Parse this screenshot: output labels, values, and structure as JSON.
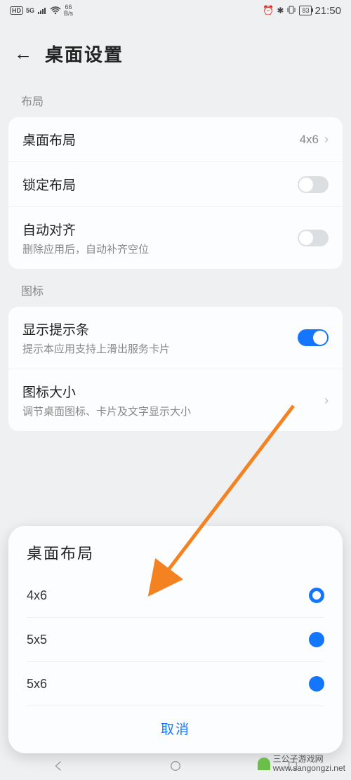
{
  "status": {
    "hd": "HD",
    "sg": "5G",
    "speed_top": "66",
    "speed_bot": "B/s",
    "battery": "83",
    "time": "21:50"
  },
  "header": {
    "title": "桌面设置"
  },
  "section1": {
    "label": "布局"
  },
  "rows": {
    "layout": {
      "title": "桌面布局",
      "value": "4x6"
    },
    "lock": {
      "title": "锁定布局"
    },
    "auto": {
      "title": "自动对齐",
      "sub": "删除应用后，自动补齐空位"
    }
  },
  "section2": {
    "label": "图标"
  },
  "rows2": {
    "hint": {
      "title": "显示提示条",
      "sub": "提示本应用支持上滑出服务卡片"
    },
    "iconsize": {
      "title": "图标大小",
      "sub": "调节桌面图标、卡片及文字显示大小"
    }
  },
  "sheet": {
    "title": "桌面布局",
    "options": [
      {
        "label": "4x6",
        "selected": true
      },
      {
        "label": "5x5",
        "selected": false
      },
      {
        "label": "5x6",
        "selected": false
      }
    ],
    "cancel": "取消"
  },
  "watermark": "三公子游戏网\nwww.sangongzi.net"
}
